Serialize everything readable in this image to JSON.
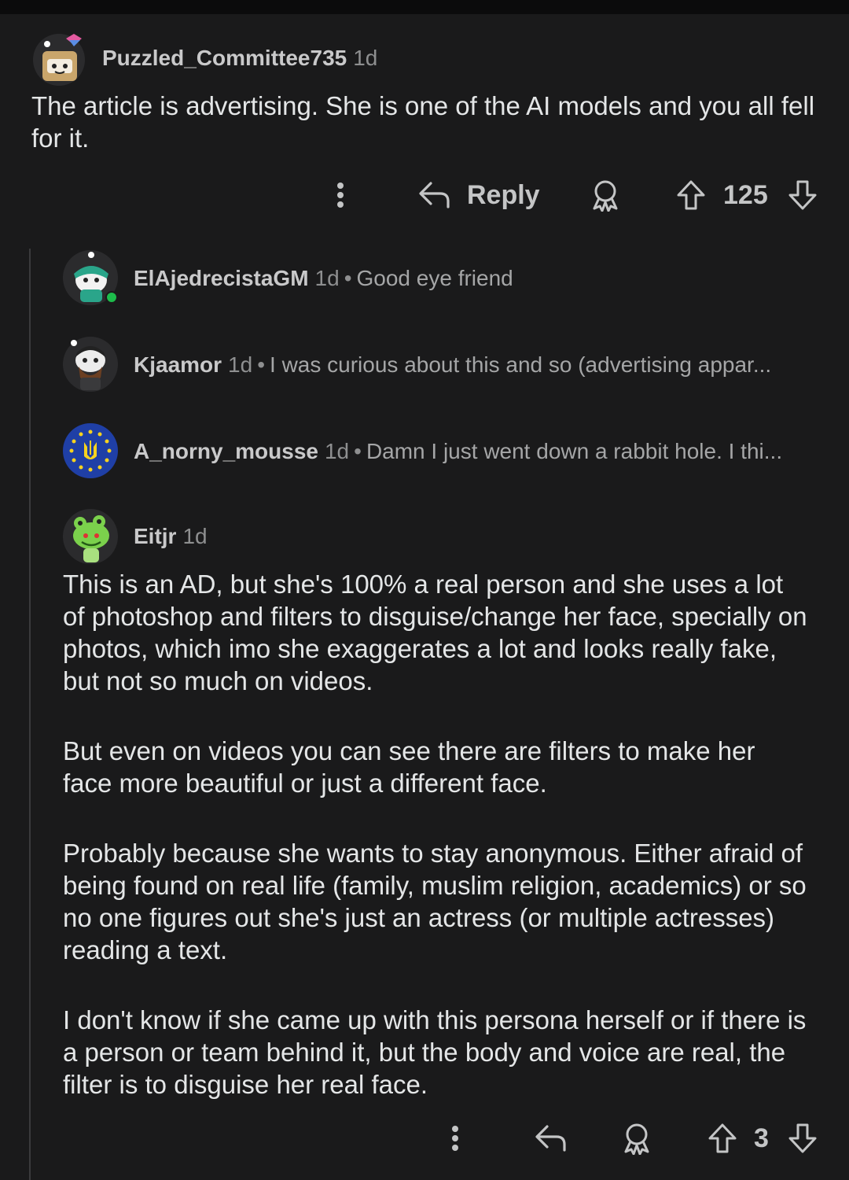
{
  "comment": {
    "username": "Puzzled_Committee735",
    "age": "1d",
    "body": "The article is advertising. She is one of the AI models and you all fell for it.",
    "reply_label": "Reply",
    "score": "125"
  },
  "replies": [
    {
      "username": "ElAjedrecistaGM",
      "age": "1d",
      "separator": "•",
      "preview": "Good eye friend"
    },
    {
      "username": "Kjaamor",
      "age": "1d",
      "separator": "•",
      "preview": "I was curious about this and so (advertising appar..."
    },
    {
      "username": "A_norny_mousse",
      "age": "1d",
      "separator": "•",
      "preview": "Damn I just went down a rabbit hole. I thi..."
    }
  ],
  "expanded_reply": {
    "username": "Eitjr",
    "age": "1d",
    "paragraphs": [
      "This is an AD, but she's 100% a real person and she uses a lot of photoshop and filters to disguise/change her face, specially on photos, which imo she exaggerates a lot and looks really fake, but not so much on videos.",
      "But even on videos you can see there are filters to make her face more beautiful or just a different face.",
      "Probably because she wants to stay anonymous. Either afraid of being found on real life (family, muslim religion, academics) or so no one figures out she's just an actress (or multiple actresses) reading a text.",
      "I don't know if she came up with this persona herself or if there is a person or team behind it, but the body and voice are real, the filter is to disguise her real face."
    ],
    "score": "3"
  },
  "icons": {
    "more": "more-vertical-icon",
    "reply": "reply-arrow-icon",
    "award": "award-icon",
    "upvote": "upvote-icon",
    "downvote": "downvote-icon"
  },
  "colors": {
    "background": "#1a1a1b",
    "text": "#e4e6e7",
    "muted": "#8e8f90",
    "online": "#1dbc4b"
  }
}
